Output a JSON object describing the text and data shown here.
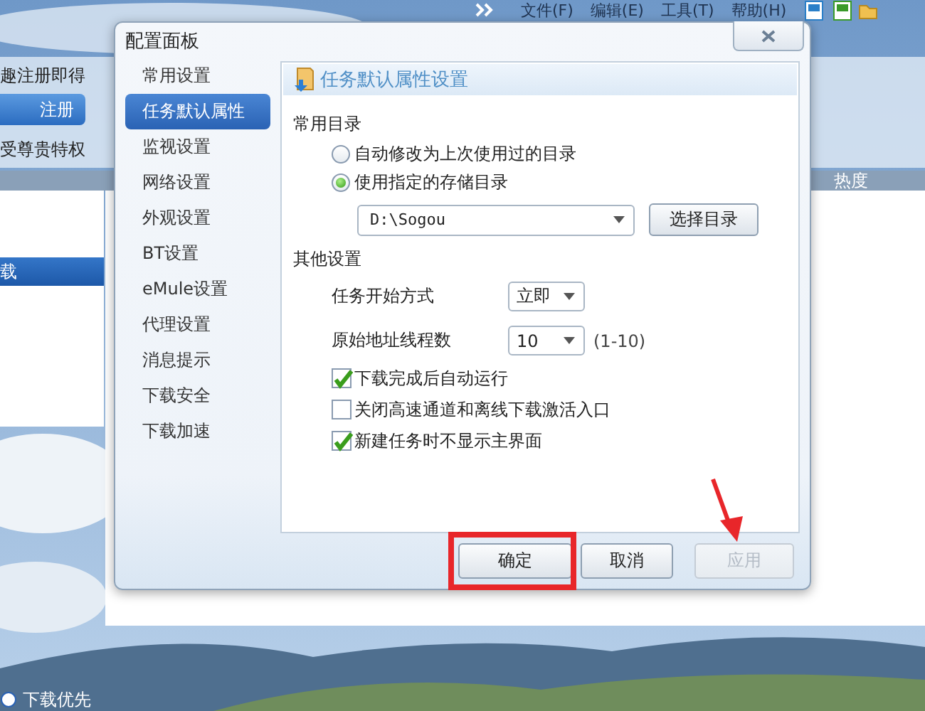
{
  "background_app": {
    "menu": [
      "文件(F)",
      "编辑(E)",
      "工具(T)",
      "帮助(H)"
    ],
    "promo_text": "趣注册即得",
    "register_button": "注册",
    "privilege_text": "受尊贵特权",
    "column_header": "热度",
    "sidebar_item": {
      "label": "载",
      "selected": true
    },
    "bottom_item": "下载优先"
  },
  "dialog": {
    "title": "配置面板",
    "nav": [
      {
        "label": "常用设置",
        "selected": false
      },
      {
        "label": "任务默认属性",
        "selected": true
      },
      {
        "label": "监视设置",
        "selected": false
      },
      {
        "label": "网络设置",
        "selected": false
      },
      {
        "label": "外观设置",
        "selected": false
      },
      {
        "label": "BT设置",
        "selected": false
      },
      {
        "label": "eMule设置",
        "selected": false
      },
      {
        "label": "代理设置",
        "selected": false
      },
      {
        "label": "消息提示",
        "selected": false
      },
      {
        "label": "下载安全",
        "selected": false
      },
      {
        "label": "下载加速",
        "selected": false
      }
    ],
    "section_header": "任务默认属性设置",
    "directory": {
      "heading": "常用目录",
      "options": [
        {
          "label": "自动修改为上次使用过的目录",
          "selected": false
        },
        {
          "label": "使用指定的存储目录",
          "selected": true
        }
      ],
      "path": "D:\\Sogou",
      "browse_button": "选择目录"
    },
    "other": {
      "heading": "其他设置",
      "fields": [
        {
          "label": "任务开始方式",
          "value": "立即"
        },
        {
          "label": "原始地址线程数",
          "value": "10",
          "hint": "(1-10)"
        }
      ],
      "checkboxes": [
        {
          "label": "下载完成后自动运行",
          "checked": true
        },
        {
          "label": "关闭高速通道和离线下载激活入口",
          "checked": false
        },
        {
          "label": "新建任务时不显示主界面",
          "checked": true
        }
      ]
    },
    "buttons": [
      {
        "label": "确定",
        "disabled": false,
        "highlighted": true,
        "arrow": false
      },
      {
        "label": "取消",
        "disabled": false,
        "highlighted": false,
        "arrow": false
      },
      {
        "label": "应用",
        "disabled": true,
        "highlighted": false,
        "arrow": true
      }
    ]
  }
}
